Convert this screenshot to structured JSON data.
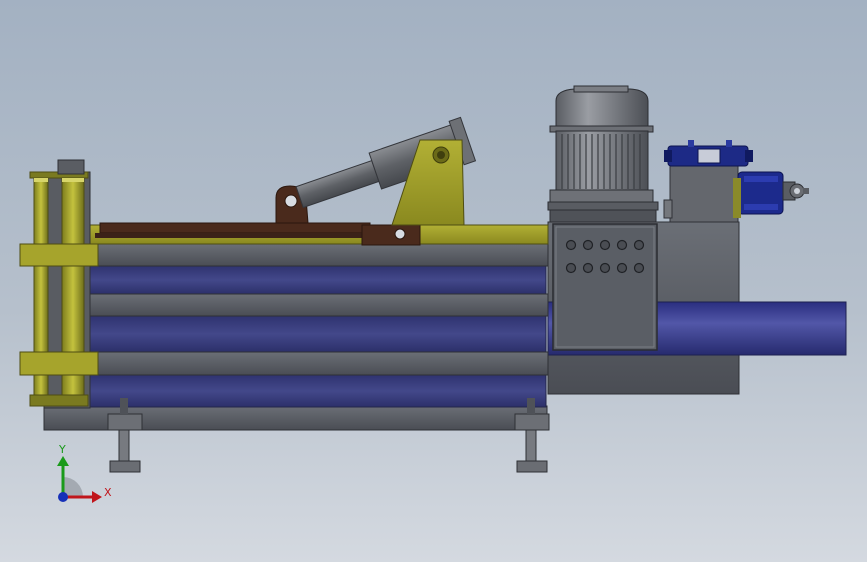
{
  "triad": {
    "x_label": "X",
    "y_label": "Y",
    "x_color": "#c0151b",
    "y_color": "#1a9a1a",
    "z_color": "#1630b8"
  },
  "palette": {
    "frame_gray": "#5b5f66",
    "frame_dark": "#3a3d43",
    "panel_blue": "#3a3f7a",
    "olive": "#a3a22b",
    "rust": "#4a2a1c",
    "cylinder": "#6a6d72",
    "valve_blue": "#1b2a8a"
  },
  "control_panel": {
    "button_rows": 2,
    "buttons_per_row": 5
  }
}
